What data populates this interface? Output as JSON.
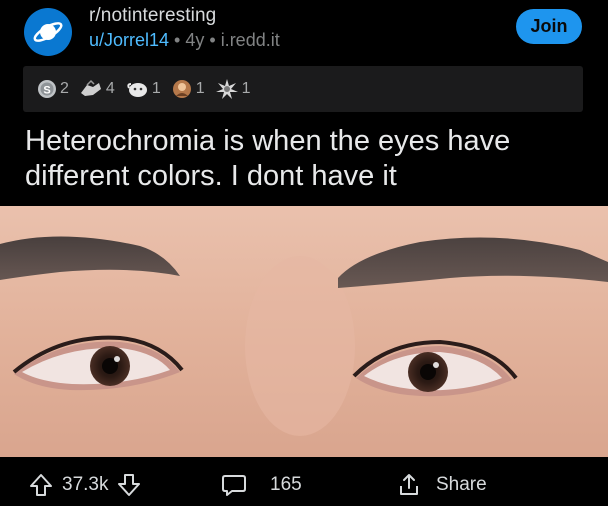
{
  "header": {
    "subreddit": "r/notinteresting",
    "user": "u/Jorrel14",
    "dot1": " • ",
    "age": "4y",
    "dot2": " • ",
    "domain": "i.redd.it",
    "join_label": "Join",
    "avatar_icon": "planet-icon"
  },
  "awards": [
    {
      "icon": "silver-coin-icon",
      "count": "2"
    },
    {
      "icon": "helping-hand-icon",
      "count": "4"
    },
    {
      "icon": "wholesome-icon",
      "count": "1"
    },
    {
      "icon": "gold-award-icon",
      "count": "1"
    },
    {
      "icon": "burst-award-icon",
      "count": "1"
    }
  ],
  "post": {
    "title": "Heterochromia is when the eyes have different colors. I dont have it"
  },
  "actions": {
    "upvotes": "37.3k",
    "comments": "165",
    "share": "Share"
  },
  "colors": {
    "background": "#000000",
    "accent": "#1e95ee",
    "link": "#4fbcff",
    "avatar": "#0a78d1"
  }
}
